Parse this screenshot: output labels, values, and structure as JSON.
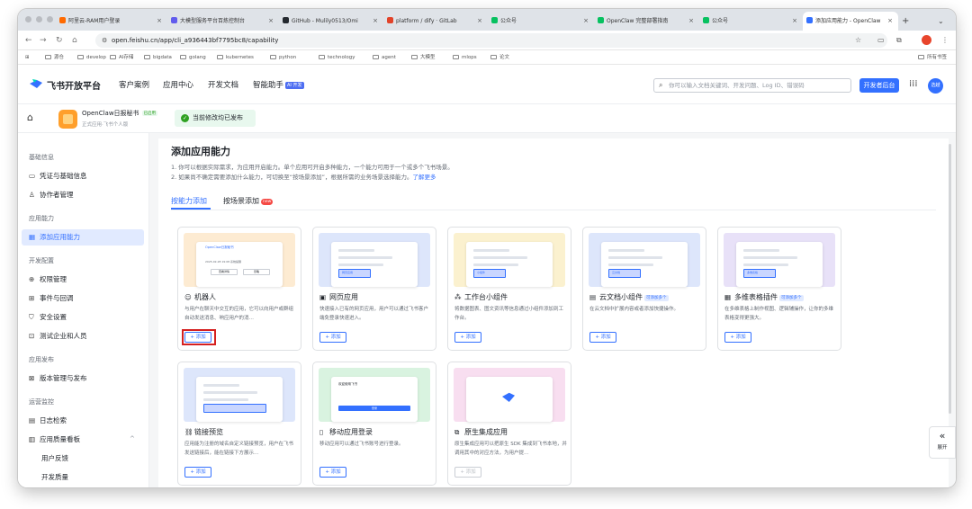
{
  "browser": {
    "tabs": [
      {
        "title": "阿里云-RAM用户登录",
        "color": "#ff6a00",
        "active": false
      },
      {
        "title": "大模型服务平台百炼控制台",
        "color": "#615ced",
        "active": false
      },
      {
        "title": "GitHub - Mulily0513/Omi",
        "color": "#24292f",
        "active": false
      },
      {
        "title": "platform / dify · GitLab",
        "color": "#e24329",
        "active": false
      },
      {
        "title": "公众号",
        "color": "#07c160",
        "active": false
      },
      {
        "title": "OpenClaw 完整部署指南",
        "color": "#07c160",
        "active": false
      },
      {
        "title": "公众号",
        "color": "#07c160",
        "active": false
      },
      {
        "title": "添加应用能力 - OpenClaw",
        "color": "#3370ff",
        "active": true
      }
    ],
    "new_tab": "+",
    "url": "open.feishu.cn/app/cli_a936443bf7795bc8/capability",
    "bookmarks": [
      "源仓",
      "develop",
      "AI存储",
      "bigdata",
      "golang",
      "kubernetes",
      "python",
      "technology",
      "agent",
      "大模型",
      "mlops",
      "论文"
    ],
    "all_bookmarks": "所有书签"
  },
  "header": {
    "brand": "飞书开放平台",
    "nav": [
      "客户案例",
      "应用中心",
      "开发文档",
      "智能助手"
    ],
    "ai_badge": "AI 开发",
    "search_placeholder": "你可以输入文档关键词、开发问题、Log ID、错误码",
    "dev_button": "开发者后台",
    "avatar_text": "选越"
  },
  "appbar": {
    "app_name": "OpenClaw日报秘书",
    "status_badge": "已启用",
    "app_subtitle": "正式应用·飞书个人版",
    "published": "当前修改均已发布"
  },
  "sidebar": {
    "sections": [
      {
        "heading": "基础信息",
        "items": [
          {
            "icon": "▭",
            "label": "凭证与基础信息"
          },
          {
            "icon": "♙",
            "label": "协作者管理"
          }
        ]
      },
      {
        "heading": "应用能力",
        "items": [
          {
            "icon": "▦",
            "label": "添加应用能力",
            "active": true
          }
        ]
      },
      {
        "heading": "开发配置",
        "items": [
          {
            "icon": "⊕",
            "label": "权限管理"
          },
          {
            "icon": "⊞",
            "label": "事件与回调"
          },
          {
            "icon": "⛉",
            "label": "安全设置"
          },
          {
            "icon": "⊡",
            "label": "测试企业和人员"
          }
        ]
      },
      {
        "heading": "应用发布",
        "items": [
          {
            "icon": "⊠",
            "label": "版本管理与发布"
          }
        ]
      },
      {
        "heading": "运营监控",
        "items": [
          {
            "icon": "▤",
            "label": "日志检索"
          },
          {
            "icon": "▥",
            "label": "应用质量看板"
          },
          {
            "icon": "",
            "label": "用户反馈",
            "sub": true
          },
          {
            "icon": "",
            "label": "开发质量",
            "sub": true
          }
        ]
      }
    ],
    "collapse_icon": "^"
  },
  "main": {
    "title": "添加应用能力",
    "desc1": "1. 你可以根据实际需求，为应用开启能力。单个应用可开启多种能力，一个能力可用于一个或多个飞书场景。",
    "desc2": "2. 如果尚不确定需要添加什么能力，可切换至“按场景添加”，根据所需的业务场景选择能力。",
    "learn_more": "了解更多",
    "tab_by_capability": "按能力添加",
    "tab_by_scene": "按场景添加",
    "new_badge": "new",
    "add_label": "+ 添加",
    "multi_badge": "可添加多个",
    "cards": [
      {
        "name": "机器人",
        "icon": "☺",
        "desc": "与用户在聊天中交互的应用，它可以向用户或群组自动发送消息、响应用户的消…",
        "bg": "#fdebd2",
        "multi": false,
        "disabled": false
      },
      {
        "name": "网页应用",
        "icon": "▣",
        "desc": "快速接入已有的网页应用，用户可以通过飞书客户端免登录快速进入。",
        "bg": "#dde6fb",
        "multi": false,
        "disabled": false
      },
      {
        "name": "工作台小组件",
        "icon": "⁂",
        "desc": "将数据图表、图文资讯等信息通过小组件添加到工作台。",
        "bg": "#fbf1cf",
        "multi": false,
        "disabled": false
      },
      {
        "name": "云文档小组件",
        "icon": "▤",
        "desc": "在云文档中扩展内容或者添加快捷操作。",
        "bg": "#dde6fb",
        "multi": true,
        "disabled": false
      },
      {
        "name": "多维表格插件",
        "icon": "▦",
        "desc": "在多维表格上制作视图、逻辑辅操作，让你的多维表格变得更强大。",
        "bg": "#e8e1f8",
        "multi": true,
        "disabled": false
      },
      {
        "name": "链接预览",
        "icon": "⛓",
        "desc": "应用能为注册的域名自定义链接预览，用户在飞书发送链接后，能在链接下方展示…",
        "bg": "#dde6fb",
        "multi": false,
        "disabled": false
      },
      {
        "name": "移动应用登录",
        "icon": "▯",
        "desc": "移动应用可以通过飞书账号进行登录。",
        "bg": "#d9f3e0",
        "multi": false,
        "disabled": false
      },
      {
        "name": "原生集成应用",
        "icon": "⧉",
        "desc": "原生集成应用可以把原生 SDK 集成到飞书本地，并调用其中的对应方法，为用户提…",
        "bg": "#f8def0",
        "multi": false,
        "disabled": true
      }
    ],
    "card1_preview": {
      "line1": "OpenClaw日报秘书",
      "line2": "2025-02-28 19:08 系统提醒",
      "btn1": "查看详情",
      "btn2": "忽略"
    },
    "card2_preview": {
      "label": "网页应用"
    },
    "card3_preview": {
      "label": "小组件"
    },
    "card4_preview": {
      "label": "云文档"
    },
    "card5_preview": {
      "label": "多维表格"
    },
    "card7_preview": {
      "label": "欢迎使用飞书",
      "btn": "登录"
    }
  },
  "expand": {
    "icon": "«",
    "label": "展开"
  }
}
